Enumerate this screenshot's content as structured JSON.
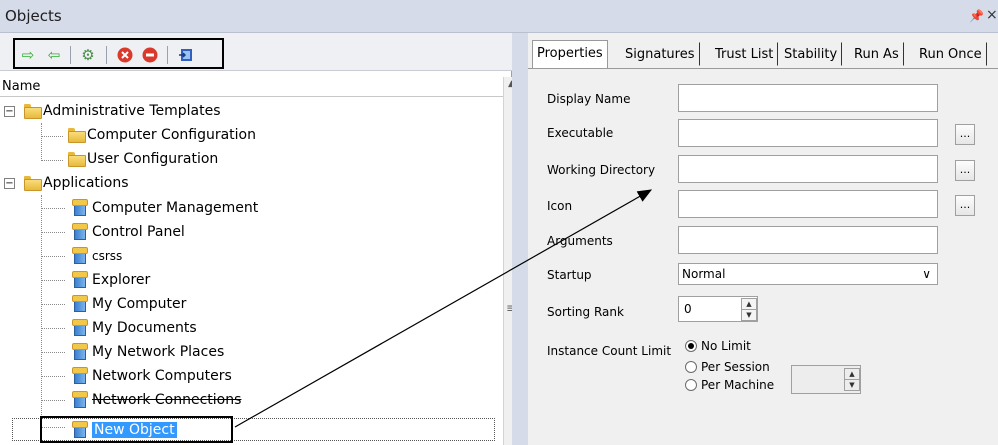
{
  "window": {
    "title": "Objects",
    "pin_glyph": "p",
    "close_glyph": "×"
  },
  "toolbar": {
    "buttons": [
      {
        "name": "forward-arrow-icon",
        "glyph": "⇨",
        "color": "#2fae2f"
      },
      {
        "name": "back-arrow-icon",
        "glyph": "⇦",
        "color": "#2fae2f"
      },
      {
        "name": "add-object-icon",
        "glyph": "⚙",
        "color": "#4a8f4a"
      },
      {
        "name": "delete-icon",
        "glyph": "✖",
        "color": "#d93a2b"
      },
      {
        "name": "remove-icon",
        "glyph": "−",
        "color": "#d93a2b"
      },
      {
        "name": "export-icon",
        "glyph": "▣",
        "color": "#2f5fbf"
      }
    ]
  },
  "tree": {
    "column_header": "Name",
    "groups": [
      {
        "label": "Administrative Templates",
        "expander": "−",
        "children": [
          "Computer Configuration",
          "User Configuration"
        ]
      },
      {
        "label": "Applications",
        "expander": "−",
        "children": [
          "Computer Management",
          "Control Panel",
          "csrss",
          "Explorer",
          "My Computer",
          "My Documents",
          "My Network Places",
          "Network Computers",
          "Network Connections",
          "New Object"
        ]
      }
    ],
    "selected": "New Object"
  },
  "tabs": [
    "Properties",
    "Signatures",
    "Trust List",
    "Stability",
    "Run As",
    "Run Once"
  ],
  "active_tab": "Properties",
  "form": {
    "display_name_label": "Display Name",
    "display_name_value": "",
    "executable_label": "Executable",
    "executable_value": "",
    "working_dir_label": "Working Directory",
    "working_dir_value": "",
    "icon_label": "Icon",
    "icon_value": "",
    "arguments_label": "Arguments",
    "arguments_value": "",
    "startup_label": "Startup",
    "startup_value": "Normal",
    "sorting_rank_label": "Sorting Rank",
    "sorting_rank_value": "0",
    "instance_label": "Instance Count Limit",
    "instance_options": [
      "No Limit",
      "Per Session",
      "Per Machine"
    ],
    "instance_selected": "No Limit",
    "browse_label": "..."
  },
  "colors": {
    "selection": "#3399ff",
    "titlebar": "#d6dbe9"
  }
}
